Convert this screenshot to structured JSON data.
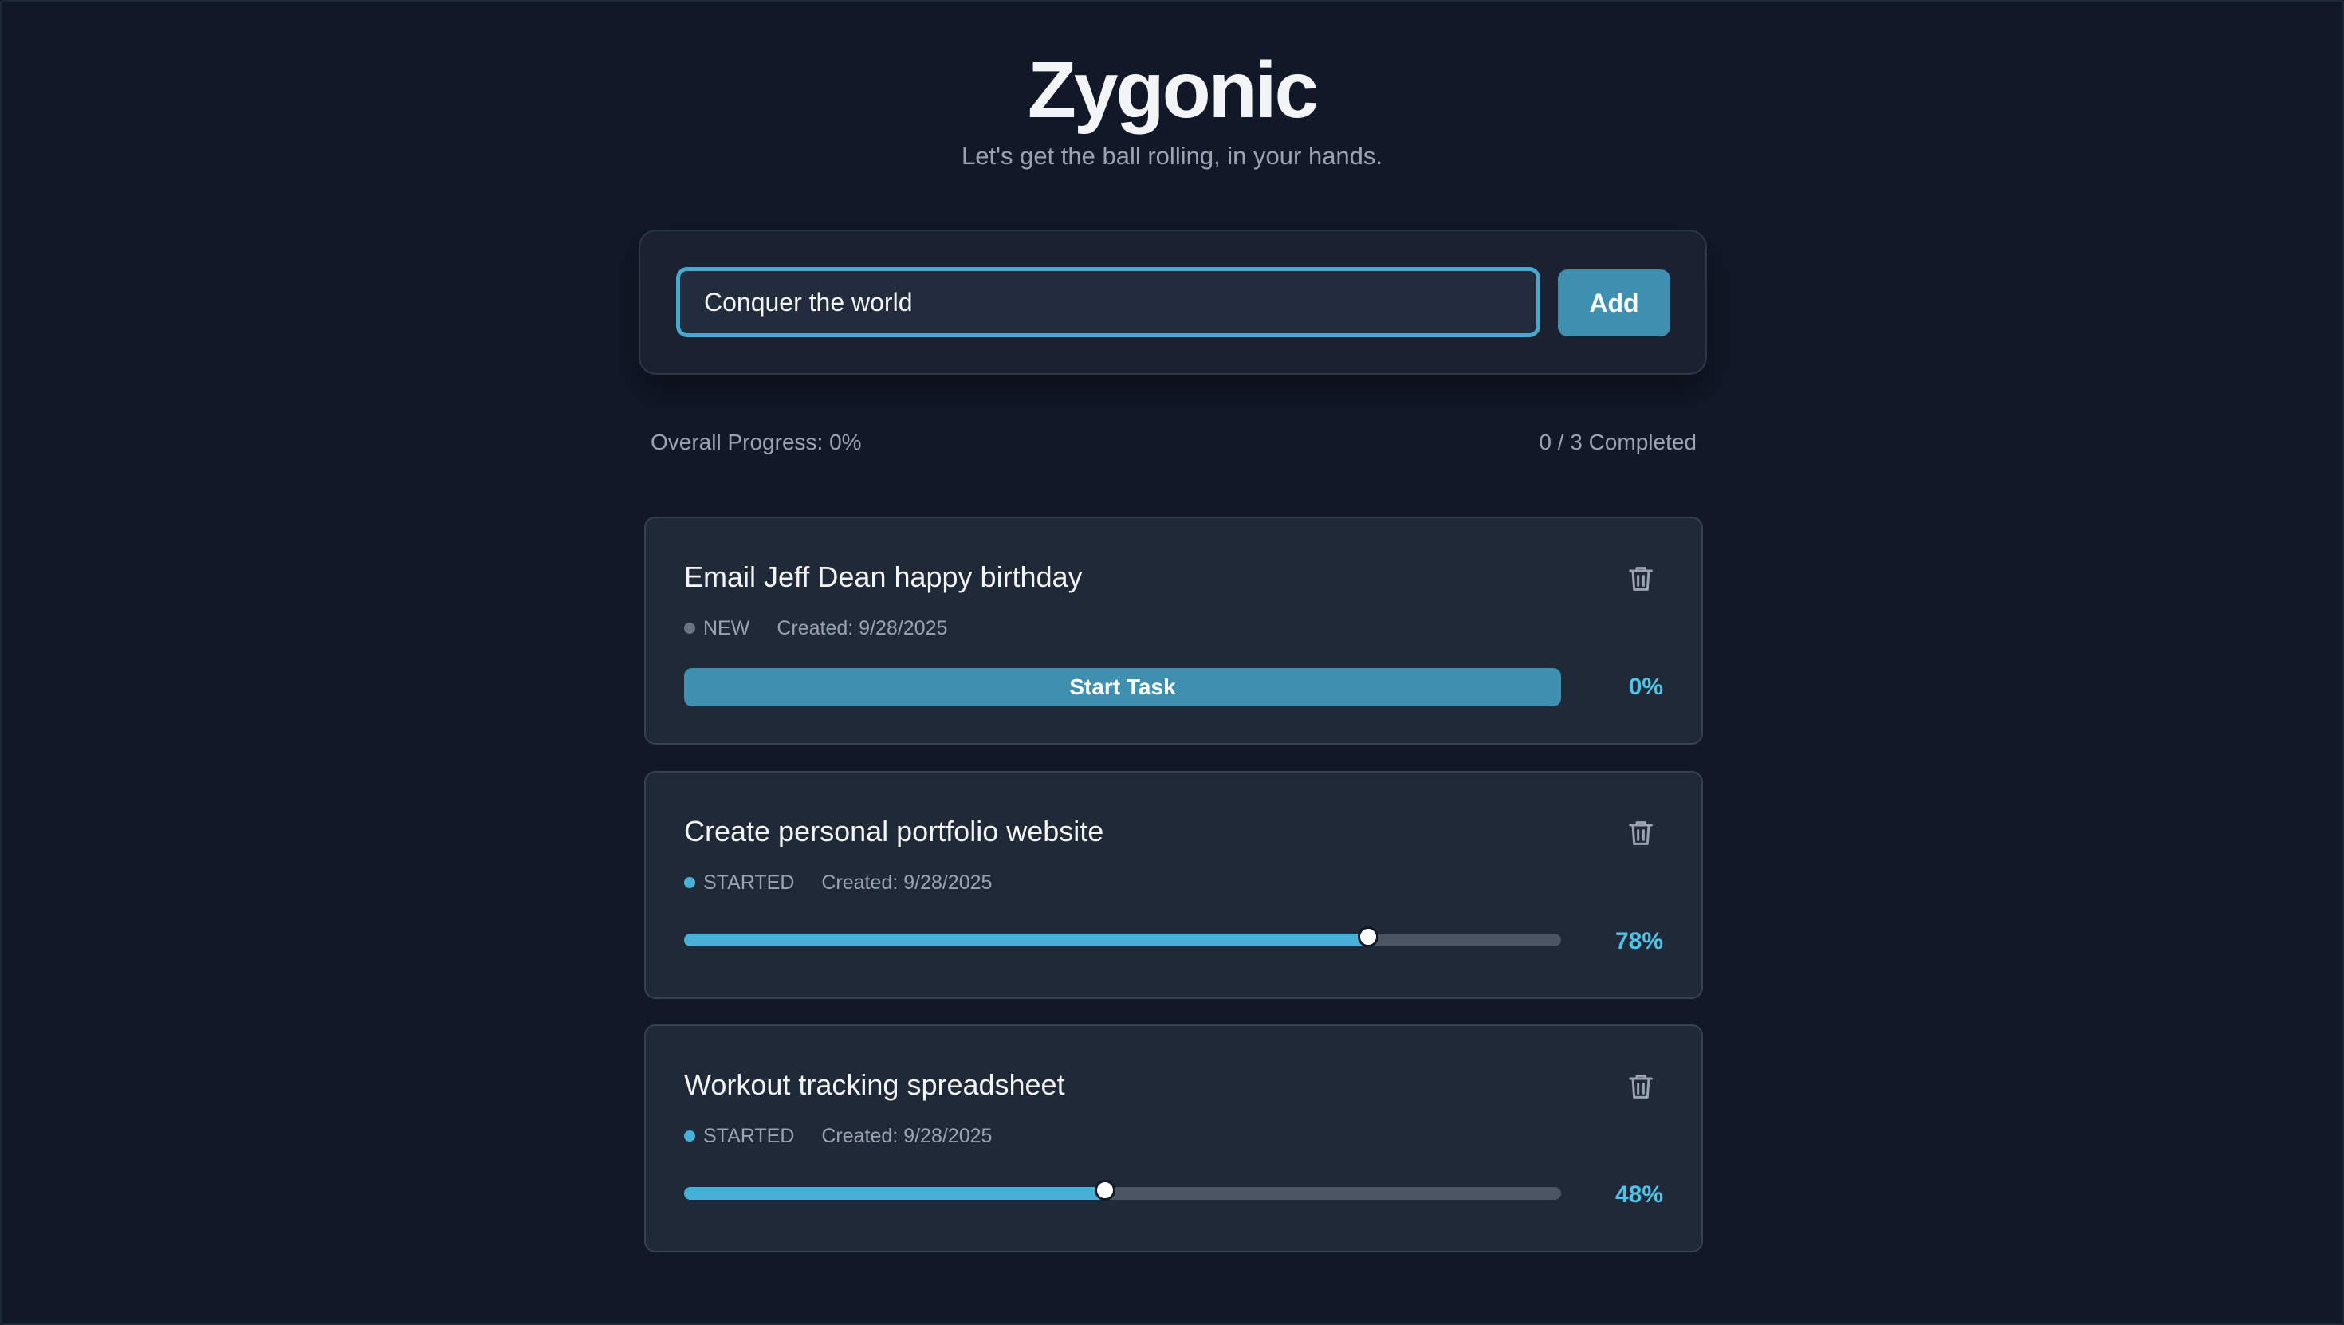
{
  "app": {
    "title": "Zygonic",
    "tagline": "Let's get the ball rolling, in your hands."
  },
  "add_form": {
    "input_value": "Conquer the world",
    "add_label": "Add"
  },
  "summary": {
    "overall_progress": "Overall Progress: 0%",
    "completed": "0 / 3 Completed"
  },
  "tasks": [
    {
      "title": "Email Jeff Dean happy birthday",
      "status": "NEW",
      "created": "Created: 9/28/2025",
      "percent": "0%",
      "progress": 0,
      "action_label": "Start Task"
    },
    {
      "title": "Create personal portfolio website",
      "status": "STARTED",
      "created": "Created: 9/28/2025",
      "percent": "78%",
      "progress": 0.78
    },
    {
      "title": "Workout tracking spreadsheet",
      "status": "STARTED",
      "created": "Created: 9/28/2025",
      "percent": "48%",
      "progress": 0.48
    }
  ],
  "colors": {
    "background": "#111827",
    "card": "#1f2937",
    "accent": "#47b0d6",
    "button": "#3f8fb0",
    "status_new": "#6b7280",
    "status_started": "#47b0d6"
  },
  "icons": {
    "delete": "trash-icon"
  }
}
